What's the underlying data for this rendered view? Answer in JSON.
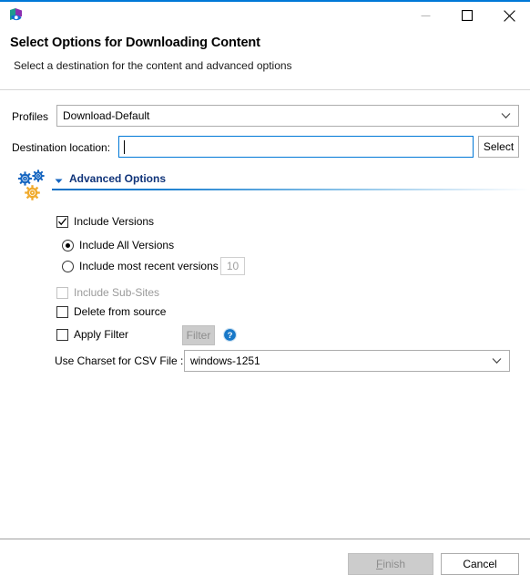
{
  "window": {
    "app_icon": "app-logo-icon",
    "buttons": [
      {
        "name": "minimize-button",
        "glyph": "minimize-icon",
        "label": "Minimize",
        "disabled": true
      },
      {
        "name": "maximize-button",
        "glyph": "maximize-icon",
        "label": "Maximize",
        "disabled": false
      },
      {
        "name": "close-button",
        "glyph": "close-icon",
        "label": "Close",
        "disabled": false
      }
    ],
    "accent_color": "#0078d7"
  },
  "header": {
    "title": "Select Options for Downloading Content",
    "subtitle": "Select a destination for the content and advanced options"
  },
  "form": {
    "profiles": {
      "label": "Profiles",
      "value": "Download-Default",
      "caret_icon": "chevron-down-icon"
    },
    "destination": {
      "label": "Destination location:",
      "value": "",
      "placeholder": "",
      "select_button": "Select"
    }
  },
  "advanced": {
    "gear_icon": "gears-icon",
    "expander_icon": "triangle-down-icon",
    "title": "Advanced Options",
    "title_color": "#10347a",
    "rule_color": "#0b6fc4",
    "include_versions": {
      "label": "Include Versions",
      "checked": true,
      "disabled": false
    },
    "version_mode": {
      "selected": "all",
      "options": [
        {
          "id": "all",
          "label": "Include All Versions",
          "selected": true
        },
        {
          "id": "recent",
          "label": "Include most recent versions",
          "selected": false
        }
      ],
      "recent_count": "10",
      "recent_count_disabled": true
    },
    "include_sub_sites": {
      "label": "Include Sub-Sites",
      "checked": false,
      "disabled": true
    },
    "delete_from_source": {
      "label": "Delete from source",
      "checked": false,
      "disabled": false
    },
    "apply_filter": {
      "label": "Apply Filter",
      "checked": false,
      "disabled": false,
      "filter_button": "Filter",
      "filter_button_disabled": true,
      "help_icon": "help-circle-icon"
    },
    "charset": {
      "label": "Use Charset for CSV File :",
      "value": "windows-1251",
      "caret_icon": "chevron-down-icon"
    }
  },
  "footer": {
    "finish_button": {
      "label": "Finish",
      "mnemonic": "F",
      "rest": "inish",
      "disabled": true
    },
    "cancel_button": {
      "label": "Cancel",
      "disabled": false
    }
  }
}
